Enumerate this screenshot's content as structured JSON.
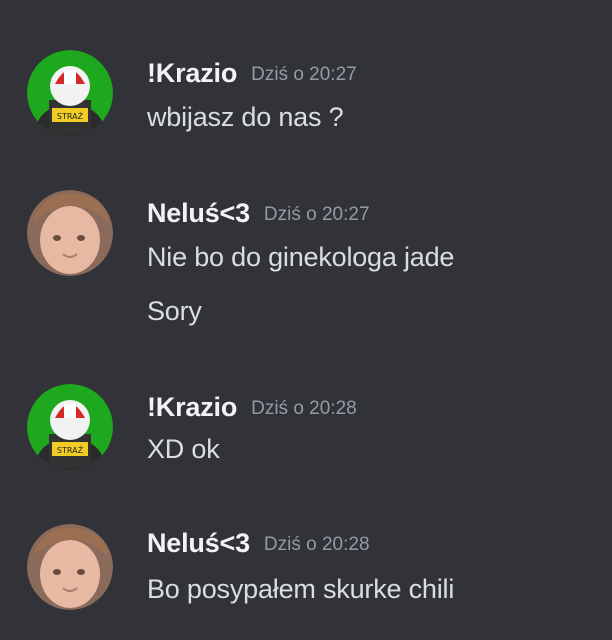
{
  "messages": [
    {
      "author": "!Krazio",
      "timestamp": "Dziś o 20:27",
      "avatar_icon": "firefighter-avatar-icon",
      "lines": [
        "wbijasz do nas ?"
      ]
    },
    {
      "author": "Neluś<3",
      "timestamp": "Dziś o 20:27",
      "avatar_icon": "user-photo-avatar-icon",
      "lines": [
        "Nie bo do ginekologa jade",
        "Sory"
      ]
    },
    {
      "author": "!Krazio",
      "timestamp": "Dziś o 20:28",
      "avatar_icon": "firefighter-avatar-icon",
      "lines": [
        "XD ok"
      ]
    },
    {
      "author": "Neluś<3",
      "timestamp": "Dziś o 20:28",
      "avatar_icon": "user-photo-avatar-icon",
      "lines": [
        "Bo posypałem skurke chili"
      ]
    }
  ],
  "avatar_badge_text": "STRAŻ",
  "colors": {
    "background": "#313338",
    "username": "#f2f3f5",
    "timestamp": "#949ba4",
    "message_text": "#dbdee1",
    "firefighter_avatar_bg": "#1ea81e"
  }
}
